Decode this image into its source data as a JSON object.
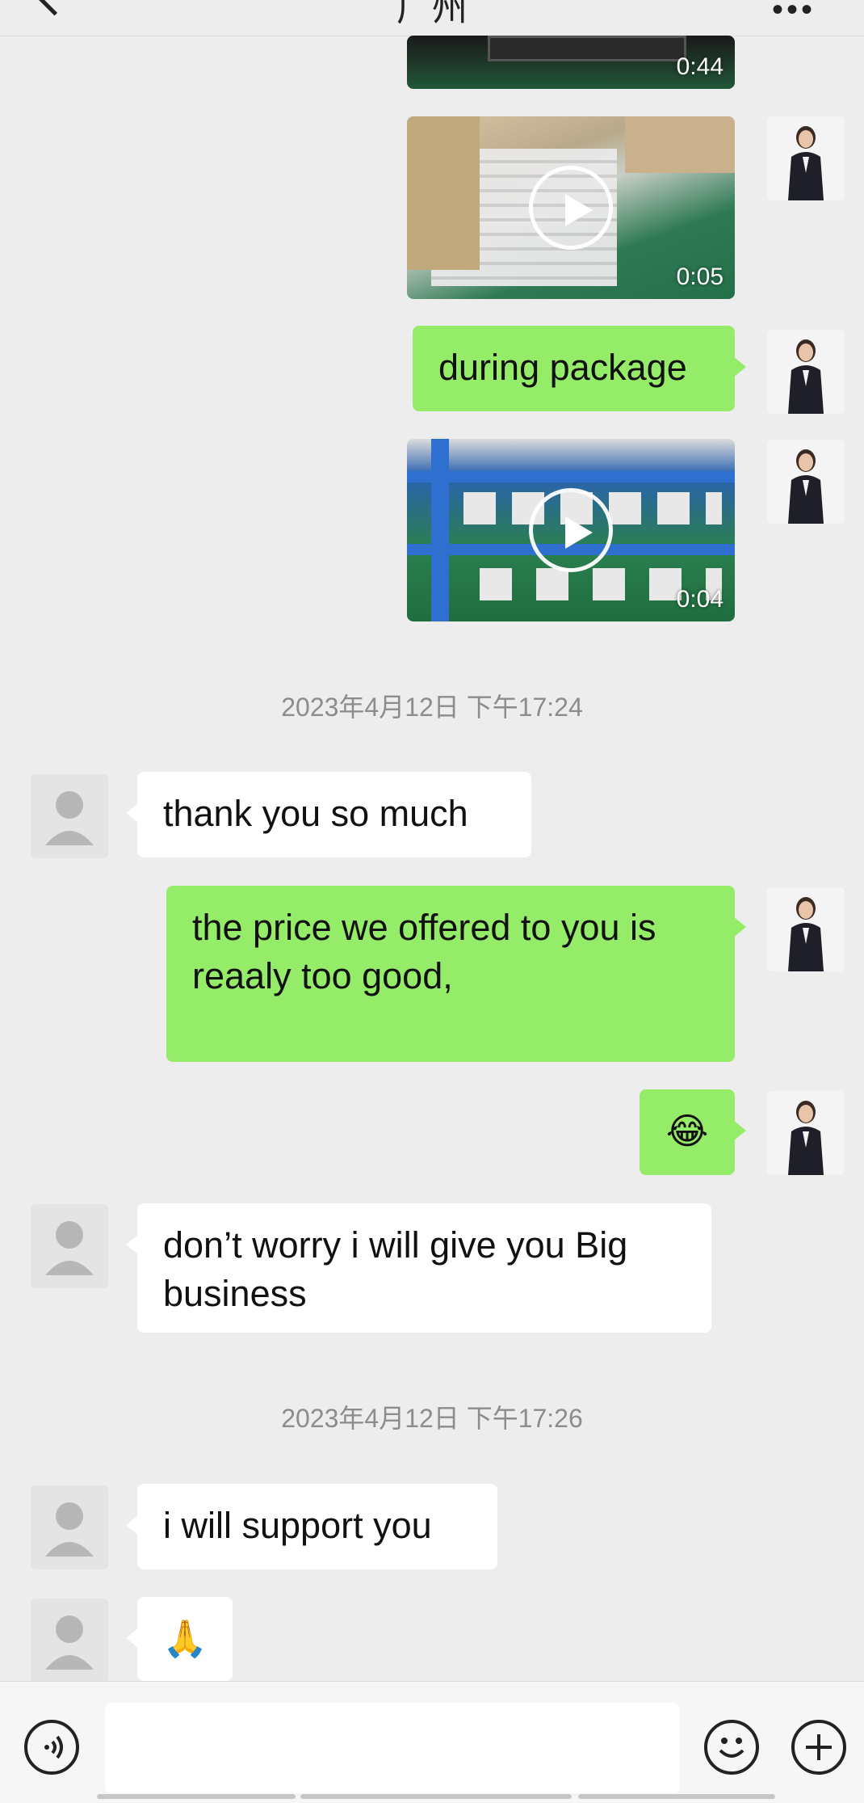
{
  "header": {
    "title": "广州",
    "back_icon": "back-arrow-icon",
    "more_icon": "more-dots-icon",
    "more_glyph": "•••"
  },
  "messages": [
    {
      "type": "video",
      "side": "out",
      "duration": "0:44"
    },
    {
      "type": "video",
      "side": "out",
      "duration": "0:05"
    },
    {
      "type": "text",
      "side": "out",
      "text": "during package"
    },
    {
      "type": "video",
      "side": "out",
      "duration": "0:04"
    },
    {
      "type": "timestamp",
      "text": "2023年4月12日 下午17:24"
    },
    {
      "type": "text",
      "side": "in",
      "text": "thank you so much"
    },
    {
      "type": "text",
      "side": "out",
      "text": "the price we offered to you is reaaly too good,"
    },
    {
      "type": "emoji",
      "side": "out",
      "text": "😂"
    },
    {
      "type": "text",
      "side": "in",
      "text": "don’t worry i will give you Big business"
    },
    {
      "type": "timestamp",
      "text": "2023年4月12日 下午17:26"
    },
    {
      "type": "text",
      "side": "in",
      "text": "i will support you"
    },
    {
      "type": "emoji",
      "side": "in",
      "text": "🙏"
    }
  ],
  "input_bar": {
    "voice_icon": "voice-icon",
    "emoji_icon": "emoji-icon",
    "plus_icon": "plus-icon",
    "text_value": ""
  },
  "colors": {
    "outgoing_bubble": "#95ec69",
    "incoming_bubble": "#ffffff",
    "background": "#ededed",
    "timestamp_text": "#8c8c8c"
  }
}
